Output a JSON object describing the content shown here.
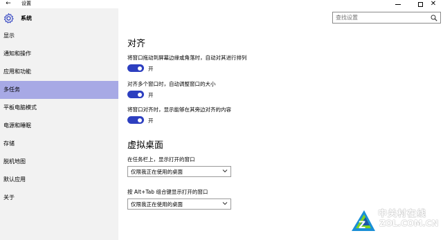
{
  "window": {
    "title": "设置",
    "back_icon": "back-arrow-icon"
  },
  "sidebar": {
    "header_label": "系统",
    "items": [
      {
        "label": "显示"
      },
      {
        "label": "通知和操作"
      },
      {
        "label": "应用和功能"
      },
      {
        "label": "多任务",
        "active": true
      },
      {
        "label": "平板电脑模式"
      },
      {
        "label": "电源和睡眠"
      },
      {
        "label": "存储"
      },
      {
        "label": "脱机地图"
      },
      {
        "label": "默认应用"
      },
      {
        "label": "关于"
      }
    ]
  },
  "search": {
    "placeholder": "查找设置"
  },
  "snap": {
    "title": "对齐",
    "settings": [
      {
        "desc": "将窗口拖动到屏幕边缘或角落时，自动对其进行排列",
        "state": "开",
        "on": true
      },
      {
        "desc": "对齐多个窗口时，自动调整窗口的大小",
        "state": "开",
        "on": true
      },
      {
        "desc": "将窗口对齐时，显示能够在其旁边对齐的内容",
        "state": "开",
        "on": true
      }
    ]
  },
  "virtual_desktops": {
    "title": "虚拟桌面",
    "taskbar_label": "在任务栏上，显示打开的窗口",
    "taskbar_value": "仅限我正在使用的桌面",
    "alttab_label": "按 Alt+Tab 组合键显示打开的窗口",
    "alttab_value": "仅限我正在使用的桌面"
  },
  "watermark": {
    "line1": "中关村在线",
    "line2": "ZOL.COM.CN"
  },
  "colors": {
    "accent": "#2d3fc0",
    "sidebar_bg": "#f2f2f2",
    "active_item": "#a7a9e5"
  }
}
